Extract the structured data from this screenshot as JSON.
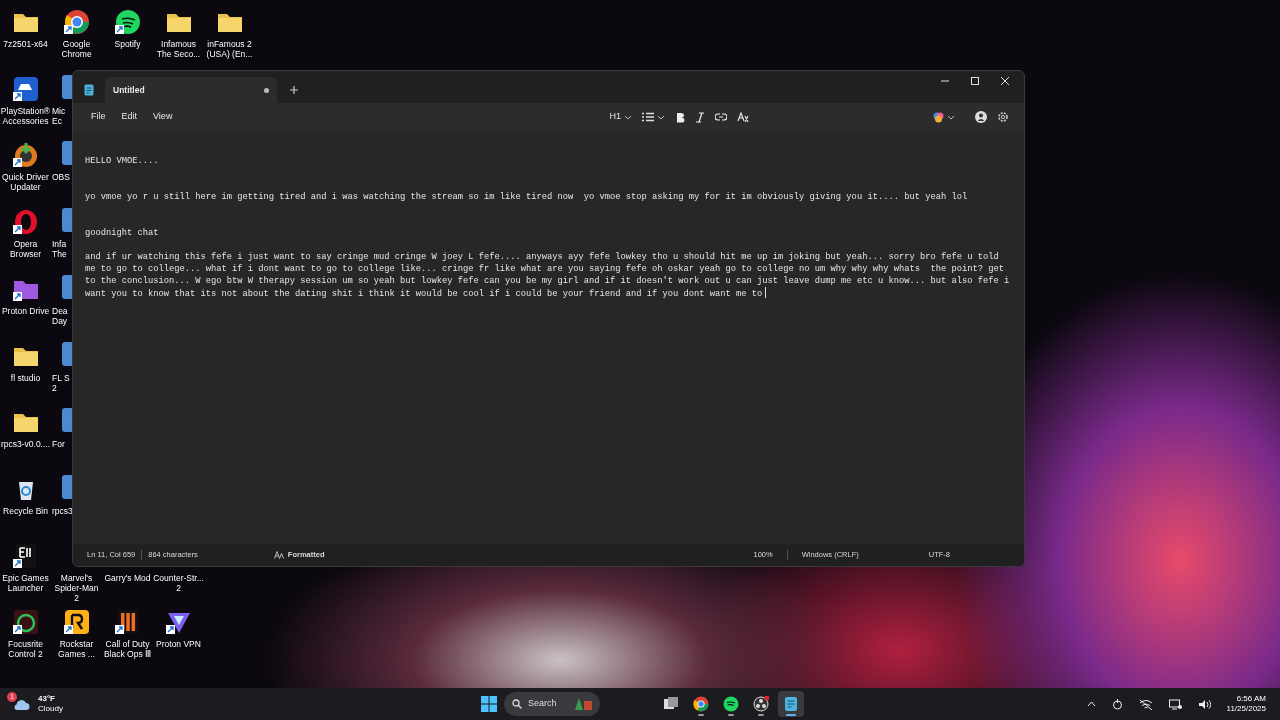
{
  "desktop_icons": [
    {
      "label": "7z2501-x64",
      "kind": "folder",
      "shortcut": false
    },
    {
      "label": "Google\nChrome",
      "kind": "app",
      "shortcut": true
    },
    {
      "label": "Spotify",
      "kind": "app",
      "shortcut": true
    },
    {
      "label": "Infamous\nThe Seco...",
      "kind": "folder",
      "shortcut": false
    },
    {
      "label": "inFamous 2\n(USA) (En...",
      "kind": "folder",
      "shortcut": false
    },
    {
      "label": "PlayStation®\nAccessories",
      "kind": "app",
      "shortcut": true
    },
    {
      "label": "Mic\nEc",
      "kind": "partial"
    },
    {
      "label": "Quick Driver\nUpdater",
      "kind": "app",
      "shortcut": true
    },
    {
      "label": "OBS",
      "kind": "partial"
    },
    {
      "label": "Opera\nBrowser",
      "kind": "app",
      "shortcut": true
    },
    {
      "label": "Infa\nThe",
      "kind": "partial"
    },
    {
      "label": "Proton Drive",
      "kind": "app",
      "shortcut": true
    },
    {
      "label": "Dea\nDay",
      "kind": "partial"
    },
    {
      "label": "fl studio",
      "kind": "folder",
      "shortcut": false
    },
    {
      "label": "FL S\n2",
      "kind": "partial"
    },
    {
      "label": "rpcs3-v0.0....",
      "kind": "folder",
      "shortcut": false
    },
    {
      "label": "For",
      "kind": "partial"
    },
    {
      "label": "Recycle Bin",
      "kind": "app",
      "shortcut": false
    },
    {
      "label": "rpcs3",
      "kind": "partial"
    },
    {
      "label": "Epic Games\nLauncher",
      "kind": "app",
      "shortcut": true
    },
    {
      "label": "Marvel's\nSpider-Man 2",
      "kind": "covered"
    },
    {
      "label": "Garry's Mod",
      "kind": "covered"
    },
    {
      "label": "Counter-Str...\n2",
      "kind": "covered"
    },
    {
      "label": "Focusrite\nControl 2",
      "kind": "app",
      "shortcut": true
    },
    {
      "label": "Rockstar\nGames ...",
      "kind": "app",
      "shortcut": true
    },
    {
      "label": "Call of Duty\nBlack Ops Ⅲ",
      "kind": "app",
      "shortcut": true
    },
    {
      "label": "Proton VPN",
      "kind": "app",
      "shortcut": true
    }
  ],
  "notepad": {
    "tab": {
      "title": "Untitled",
      "unsaved": true
    },
    "menu": [
      "File",
      "Edit",
      "View"
    ],
    "toolbar": {
      "heading": "H1"
    },
    "lines": [
      {
        "text": "HELLO VMOE...."
      },
      {
        "text": "yo vmoe yo r u still here im getting tired and i was watching the stream so im like tired now  yo vmoe stop asking my for it im obviously giving you it.... but yeah lol"
      },
      {
        "text": "goodnight chat"
      },
      {
        "text": "and if ur watching this fefe i just want to say cringe mud cringe W joey L fefe.... anyways ayy fefe lowkey tho u should hit me up im joking but yeah... sorry bro fefe u told me to go to college... what if i dont want to go to college like... cringe fr like what are you saying fefe oh oskar yeah go to college no um why why why whats  the point? get to the conclusion... W ego btw W therapy session um so yeah but lowkey fefe can you be my girl and if it doesn't work out u can just leave dump me etc u know... but also fefe i want you to know that its not about the dating shit i think it would be cool if i could be your friend and if you dont want me to"
      }
    ],
    "status": {
      "position": "Ln 11, Col 659",
      "count": "864 characters",
      "format": "Formatted",
      "zoom": "100%",
      "line_ending": "Windows (CRLF)",
      "encoding": "UTF-8"
    }
  },
  "taskbar": {
    "weather": {
      "badge": "1",
      "temperature": "43°F",
      "condition": "Cloudy"
    },
    "search": {
      "placeholder": "Search"
    },
    "apps": [
      {
        "kind": "taskview",
        "running": false,
        "active": false
      },
      {
        "kind": "chrome",
        "running": true,
        "active": false
      },
      {
        "kind": "spotify",
        "running": true,
        "active": false
      },
      {
        "kind": "obs",
        "running": true,
        "active": false
      },
      {
        "kind": "notepad",
        "running": true,
        "active": true
      }
    ],
    "time": "6:56 AM",
    "date": "11/25/2025"
  }
}
